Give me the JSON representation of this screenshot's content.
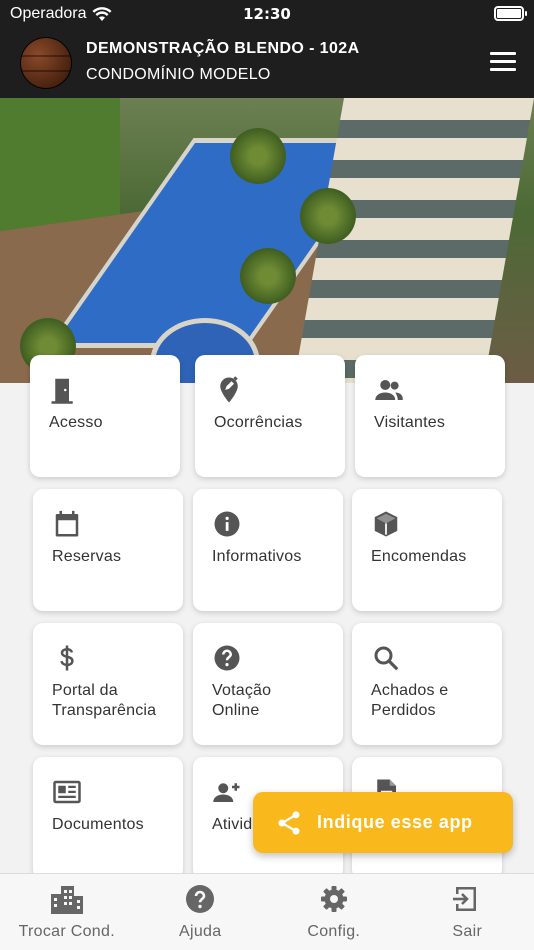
{
  "status": {
    "carrier": "Operadora",
    "time": "12:30"
  },
  "header": {
    "title": "DEMONSTRAÇÃO BLENDO - 102A",
    "subtitle": "CONDOMÍNIO MODELO"
  },
  "tiles": [
    {
      "label": "Acesso",
      "icon": "door-icon"
    },
    {
      "label": "Ocorrências",
      "icon": "edit-location-icon"
    },
    {
      "label": "Visitantes",
      "icon": "people-icon"
    },
    {
      "label": "Reservas",
      "icon": "calendar-icon"
    },
    {
      "label": "Informativos",
      "icon": "info-icon"
    },
    {
      "label": "Encomendas",
      "icon": "package-icon"
    },
    {
      "label": "Portal da\nTransparência",
      "icon": "dollar-icon"
    },
    {
      "label": "Votação\nOnline",
      "icon": "help-circle-icon"
    },
    {
      "label": "Achados e\nPerdidos",
      "icon": "search-icon"
    },
    {
      "label": "Documentos",
      "icon": "newspaper-icon"
    },
    {
      "label": "Ativid",
      "icon": "person-add-icon"
    },
    {
      "label": "",
      "icon": "document-icon"
    }
  ],
  "share": {
    "label": "Indique esse app",
    "icon": "share-icon",
    "color": "#f9b91c"
  },
  "tabs": [
    {
      "label": "Trocar Cond.",
      "icon": "buildings-icon"
    },
    {
      "label": "Ajuda",
      "icon": "help-icon"
    },
    {
      "label": "Config.",
      "icon": "gear-icon"
    },
    {
      "label": "Sair",
      "icon": "exit-icon"
    }
  ],
  "colors": {
    "header": "#1e1e1e",
    "icon": "#555555",
    "tab_icon": "#666666",
    "accent": "#f9b91c"
  }
}
